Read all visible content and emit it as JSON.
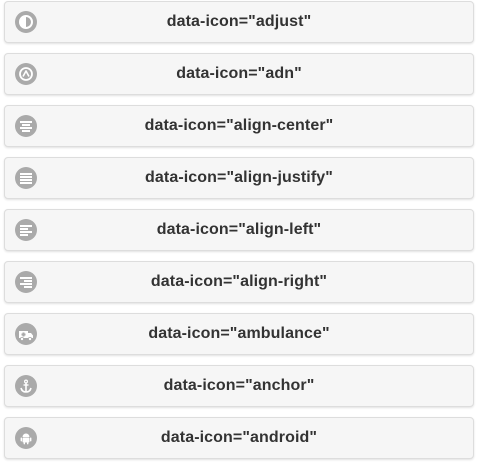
{
  "buttons": [
    {
      "label": "data-icon=\"adjust\"",
      "icon": "adjust-icon"
    },
    {
      "label": "data-icon=\"adn\"",
      "icon": "adn-icon"
    },
    {
      "label": "data-icon=\"align-center\"",
      "icon": "align-center-icon"
    },
    {
      "label": "data-icon=\"align-justify\"",
      "icon": "align-justify-icon"
    },
    {
      "label": "data-icon=\"align-left\"",
      "icon": "align-left-icon"
    },
    {
      "label": "data-icon=\"align-right\"",
      "icon": "align-right-icon"
    },
    {
      "label": "data-icon=\"ambulance\"",
      "icon": "ambulance-icon"
    },
    {
      "label": "data-icon=\"anchor\"",
      "icon": "anchor-icon"
    },
    {
      "label": "data-icon=\"android\"",
      "icon": "android-icon"
    }
  ],
  "colors": {
    "button_bg": "#f6f6f6",
    "button_border": "#dddddd",
    "icon_disc": "#aaaaaa",
    "text": "#333333"
  }
}
